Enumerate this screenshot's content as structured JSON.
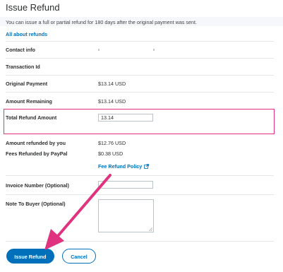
{
  "header": {
    "title": "Issue Refund",
    "info_text": "You can issue a full or partial refund for 180 days after the original payment was sent.",
    "about_link": "All about refunds"
  },
  "form": {
    "contact_info_label": "Contact info",
    "transaction_id_label": "Transaction Id",
    "original_payment_label": "Original Payment",
    "original_payment_value": "$13.14 USD",
    "amount_remaining_label": "Amount Remaining",
    "amount_remaining_value": "$13.14 USD",
    "total_refund_label": "Total Refund Amount",
    "total_refund_value": "13.14",
    "amount_refunded_label": "Amount refunded by you",
    "amount_refunded_value": "$12.76 USD",
    "fees_refunded_label": "Fees Refunded by PayPal",
    "fees_refunded_value": "$0.38 USD",
    "fee_policy_link": "Fee Refund Policy",
    "invoice_label": "Invoice Number (Optional)",
    "invoice_value": "",
    "note_label": "Note To Buyer (Optional)",
    "note_value": ""
  },
  "actions": {
    "issue_refund": "Issue Refund",
    "cancel": "Cancel"
  },
  "colors": {
    "accent": "#0070ba",
    "highlight": "#e0327e"
  },
  "icons": {
    "external_link": "external-link-icon",
    "annotation_arrow": "arrow-annotation"
  }
}
